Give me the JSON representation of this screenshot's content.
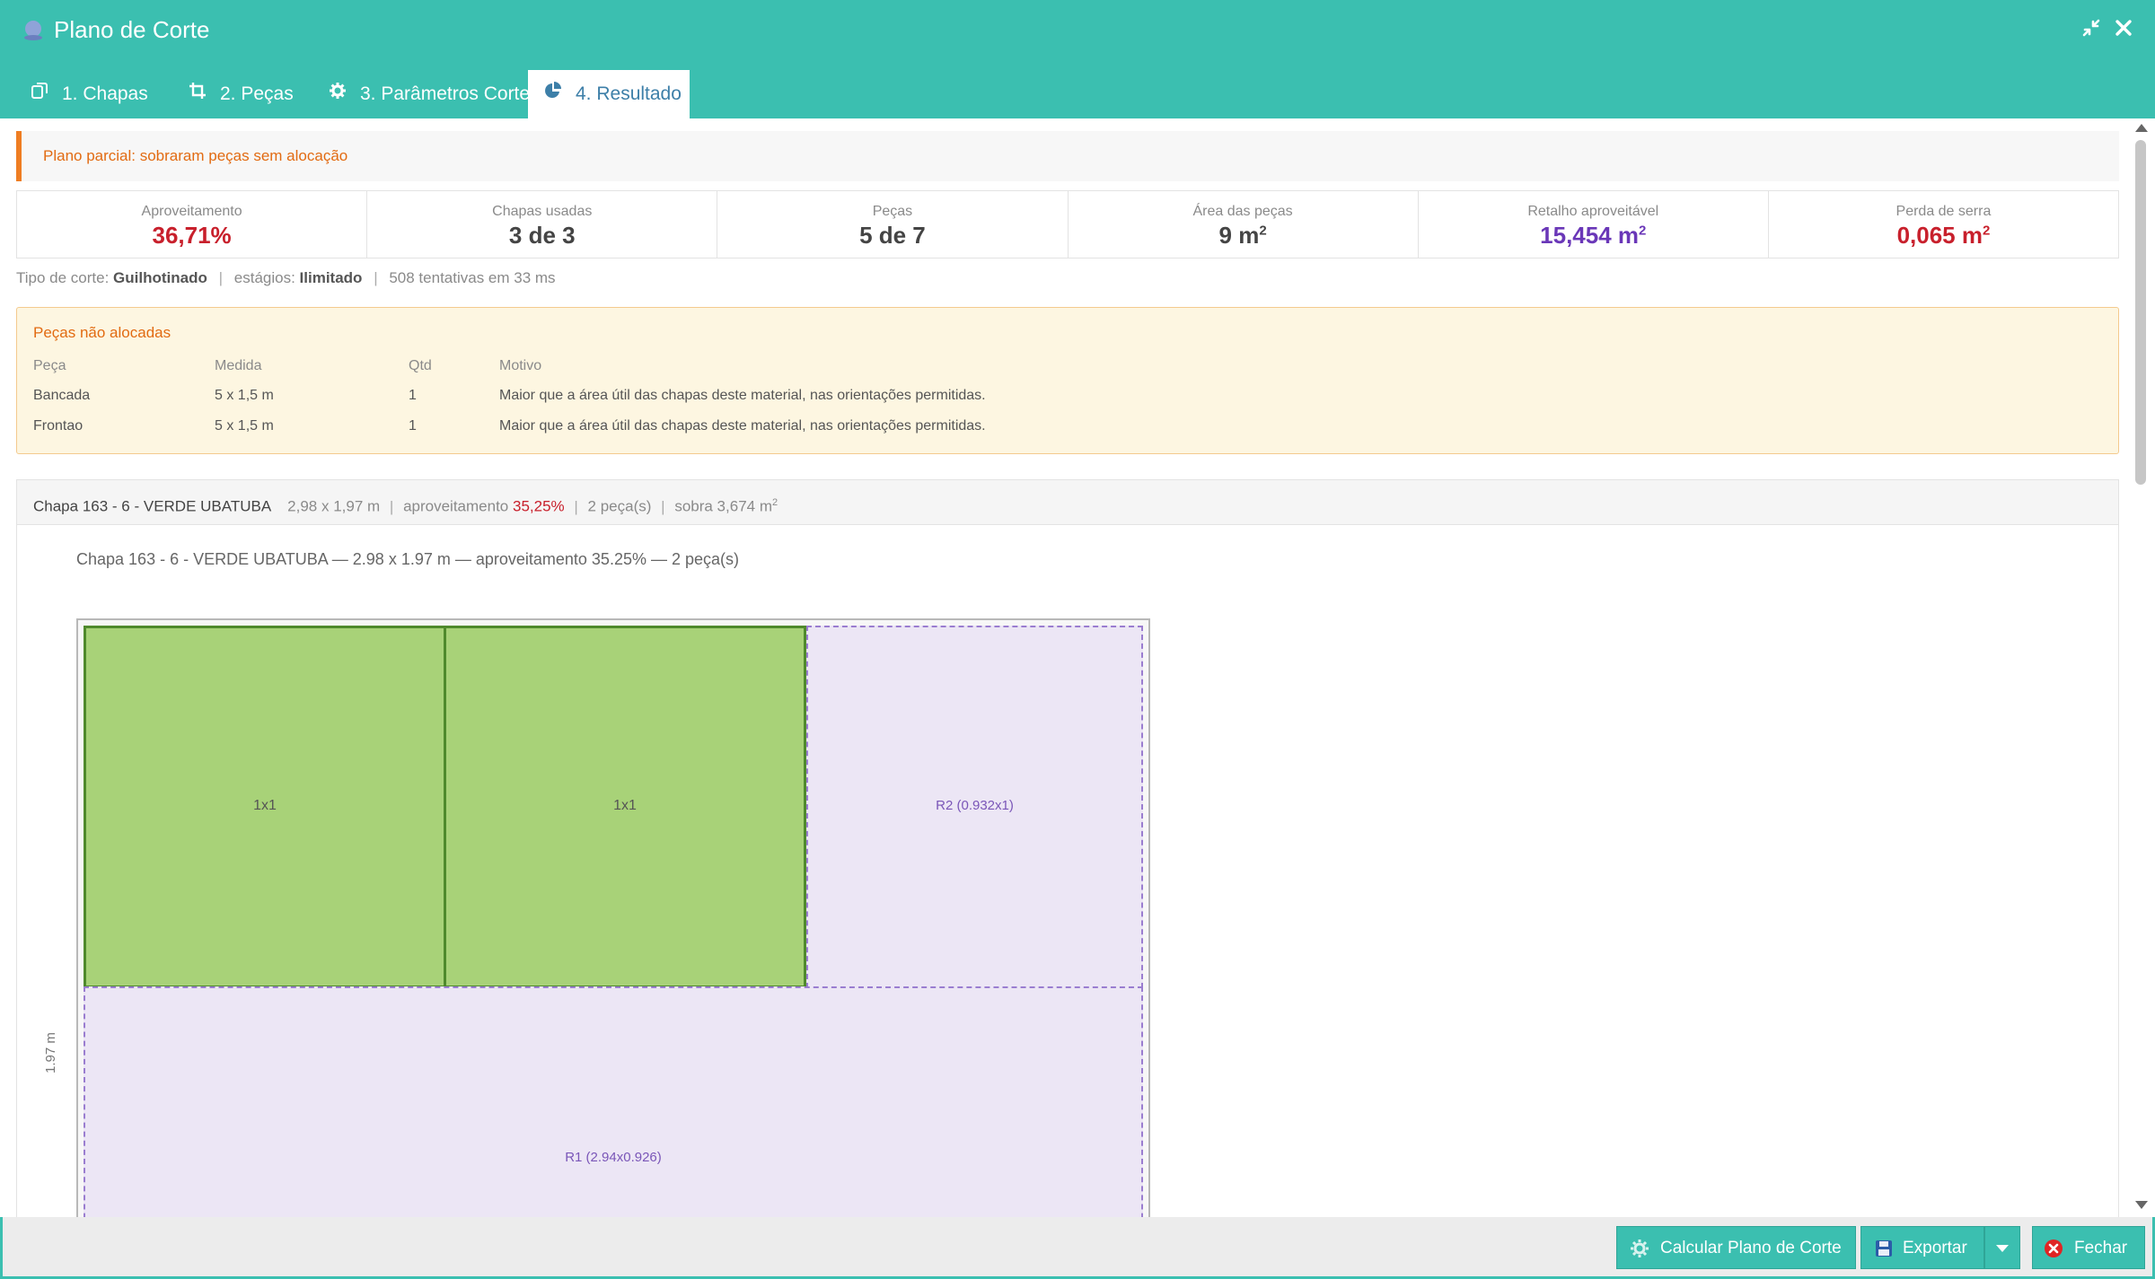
{
  "window": {
    "title": "Plano de Corte"
  },
  "tabs": [
    {
      "label": "1. Chapas",
      "icon": "copy-icon"
    },
    {
      "label": "2. Peças",
      "icon": "crop-icon"
    },
    {
      "label": "3. Parâmetros Corte",
      "icon": "gear-icon"
    },
    {
      "label": "4. Resultado",
      "icon": "pie-chart-icon",
      "active": true
    }
  ],
  "alert": {
    "text": "Plano parcial: sobraram peças sem alocação"
  },
  "stats": [
    {
      "label": "Aproveitamento",
      "value": "36,71%",
      "unit": ""
    },
    {
      "label": "Chapas usadas",
      "value": "3 de 3",
      "unit": ""
    },
    {
      "label": "Peças",
      "value": "5 de 7",
      "unit": ""
    },
    {
      "label": "Área das peças",
      "value": "9 m",
      "unit": "2"
    },
    {
      "label": "Retalho aproveitável",
      "value": "15,454 m",
      "unit": "2"
    },
    {
      "label": "Perda de serra",
      "value": "0,065 m",
      "unit": "2"
    }
  ],
  "cut_info": {
    "type_label": "Tipo de corte:",
    "type_value": "Guilhotinado",
    "stages_label": "estágios:",
    "stages_value": "Ilimitado",
    "attempts": "508 tentativas em 33 ms"
  },
  "unallocated": {
    "title": "Peças não alocadas",
    "headers": [
      "Peça",
      "Medida",
      "Qtd",
      "Motivo"
    ],
    "rows": [
      [
        "Bancada",
        "5 x 1,5 m",
        "1",
        "Maior que a área útil das chapas deste material, nas orientações permitidas."
      ],
      [
        "Frontao",
        "5 x 1,5 m",
        "1",
        "Maior que a área útil das chapas deste material, nas orientações permitidas."
      ]
    ]
  },
  "sheet": {
    "name": "Chapa 163 - 6 - VERDE UBATUBA",
    "size": "2,98 x 1,97 m",
    "usage_label": "aproveitamento",
    "usage_value": "35,25%",
    "pieces": "2 peça(s)",
    "leftover": "sobra 3,674 m",
    "leftover_sup": "2",
    "caption": "Chapa 163 - 6 - VERDE UBATUBA — 2.98 x 1.97 m — aproveitamento 35.25% — 2 peça(s)",
    "height_label": "1.97 m",
    "pieces_list": [
      {
        "label": "1x1"
      },
      {
        "label": "1x1"
      }
    ],
    "remnants": [
      {
        "label": "R2 (0.932x1)"
      },
      {
        "label": "R1 (2.94x0.926)"
      }
    ]
  },
  "footer": {
    "calc_label": "Calcular Plano de Corte",
    "export_label": "Exportar",
    "close_label": "Fechar"
  },
  "colors": {
    "accent": "#3bbfb0",
    "piece_fill": "#a8d278",
    "piece_border": "#4f8a2c",
    "remnant_fill": "#ece6f5",
    "remnant_border": "#9a7dd0",
    "alert": "#ef7d22",
    "danger": "#c8202c",
    "purple": "#6a37b8"
  }
}
